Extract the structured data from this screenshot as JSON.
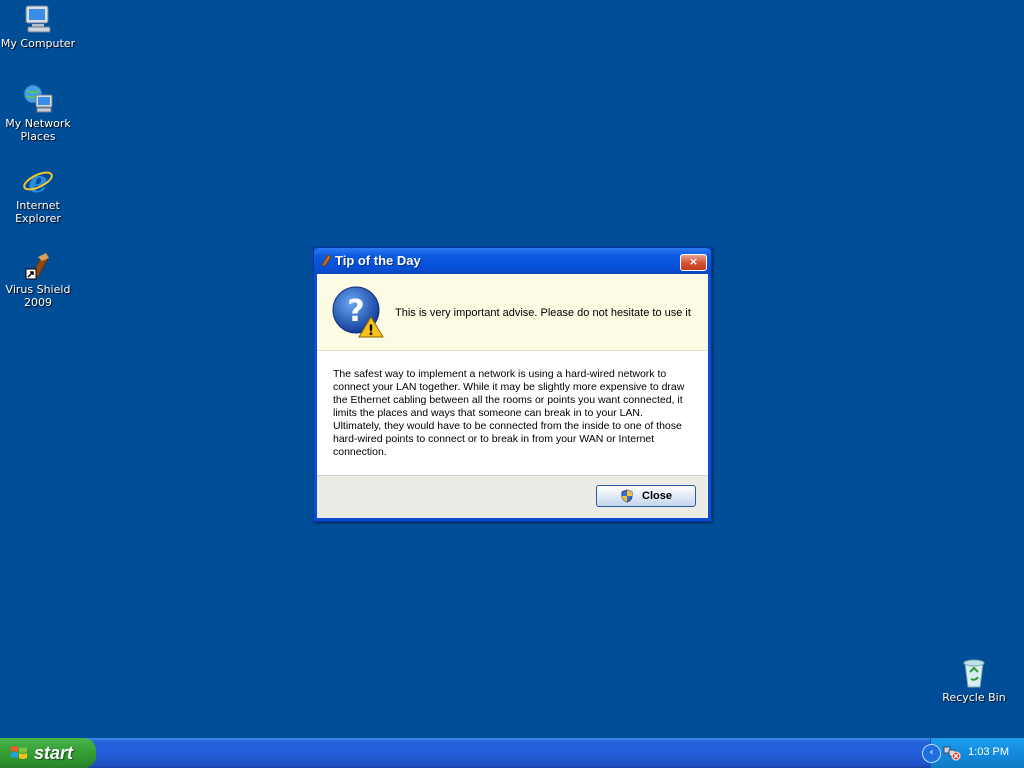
{
  "desktop": {
    "icons": [
      {
        "label": "My Computer",
        "icon": "computer-icon"
      },
      {
        "label": "My Network\nPlaces",
        "icon": "network-places-icon"
      },
      {
        "label": "Internet\nExplorer",
        "icon": "internet-explorer-icon"
      },
      {
        "label": "Virus Shield\n2009",
        "icon": "virus-shield-icon"
      },
      {
        "label": "Recycle Bin",
        "icon": "recycle-bin-icon"
      }
    ]
  },
  "dialog": {
    "title": "Tip of the Day",
    "header_text": "This is very important advise. Please do not hesitate to use it",
    "body_text": "The safest way to implement a network is using a hard-wired network to connect your LAN together. While it may be slightly more expensive to draw the Ethernet cabling between all the rooms or points you want connected, it limits the places and ways that someone can break in to your LAN. Ultimately, they would have to be connected from the inside to one of those hard-wired points to connect or to break in from your WAN or Internet connection.",
    "close_button_label": "Close",
    "close_x": "×"
  },
  "taskbar": {
    "start_label": "start",
    "clock": "1:03 PM",
    "chevron": "‹"
  },
  "colors": {
    "desktop_bg": "#004e98",
    "taskbar_blue": "#245edb",
    "start_green": "#37a337",
    "header_band": "#fefbe4"
  }
}
